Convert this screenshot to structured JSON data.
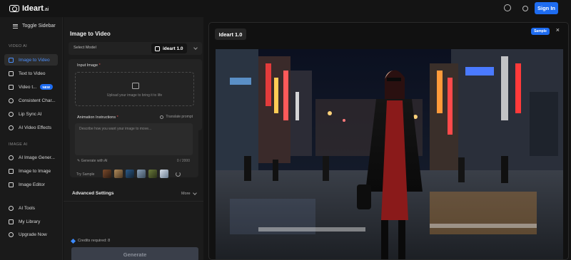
{
  "app": {
    "name": "Ideart",
    "suffix": ".ai"
  },
  "header": {
    "sign_in_label": "Sign In"
  },
  "sidebar": {
    "toggle_label": "Toggle Sidebar",
    "section_video": "VIDEO AI",
    "video_items": [
      {
        "label": "Image to Video"
      },
      {
        "label": "Text to Video"
      },
      {
        "label": "Video t...",
        "badge": "NEW"
      },
      {
        "label": "Consistent Char..."
      },
      {
        "label": "Lip Sync AI"
      },
      {
        "label": "AI Video Effects"
      }
    ],
    "section_image": "IMAGE AI",
    "image_items": [
      {
        "label": "AI Image Gener..."
      },
      {
        "label": "Image to Image"
      },
      {
        "label": "Image Editor"
      }
    ],
    "bottom_items": [
      {
        "label": "AI Tools"
      },
      {
        "label": "My Library"
      },
      {
        "label": "Upgrade Now"
      }
    ]
  },
  "panel": {
    "title": "Image to Video",
    "select_model_label": "Select Model",
    "model_value": "ideart 1.0",
    "input_image_label": "Input Image",
    "required_mark": "*",
    "upload_text": "Upload your image to bring it to life",
    "animation_label": "Animation Instructions",
    "translate_label": "Translate prompt",
    "prompt_placeholder": "Describe how you want your image to move...",
    "generate_ai_label": "Generate with AI",
    "char_counter": "0 / 2000",
    "try_sample_label": "Try Sample",
    "advanced_label": "Advanced Settings",
    "more_label": "More",
    "credits_text": "Credits required: 8",
    "generate_label": "Generate"
  },
  "preview": {
    "model_chip": "Ideart 1.0",
    "sample_badge": "Sample",
    "close_symbol": "×"
  },
  "colors": {
    "accent": "#1e6cf0",
    "active_text": "#4c90ff",
    "required": "#e64a4a"
  }
}
